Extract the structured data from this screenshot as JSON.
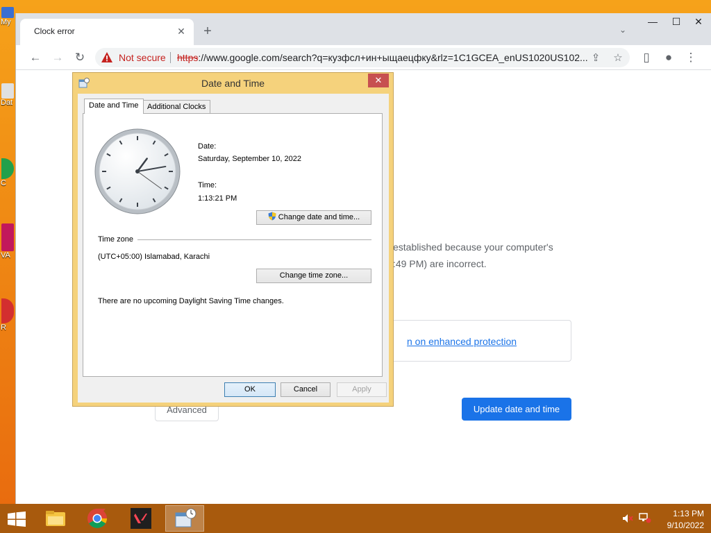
{
  "desktop": {
    "icons": [
      {
        "label": "My",
        "color": "#3b6fd1"
      },
      {
        "label": "Dat",
        "color": "#e0e0e0"
      },
      {
        "label": "C",
        "color": "#22a04b"
      },
      {
        "label": "VA",
        "color": "#c2185b"
      },
      {
        "label": "R",
        "color": "#d32f2f"
      }
    ]
  },
  "browser": {
    "tab_title": "Clock error",
    "url_scheme": "https",
    "url_rest": "://www.google.com/search?q=кузфсл+ин+ыщаецфку&rlz=1C1GCEA_enUS1020US102...",
    "not_secure": "Not secure",
    "icons": {
      "back": "←",
      "forward": "→",
      "reload": "↻",
      "share": "⇪",
      "star": "☆",
      "sidepanel": "▯",
      "profile": "●",
      "menu": "⋮",
      "newtab": "+",
      "close": "✕",
      "tabsearch": "⌄",
      "minimize": "—",
      "maximize": "☐",
      "window_close": "✕"
    }
  },
  "page": {
    "error_line1": "established because your computer's",
    "error_line2": ":49 PM) are incorrect.",
    "enhanced_link": "n on enhanced protection",
    "advanced_button": "Advanced",
    "update_button": "Update date and time"
  },
  "dialog": {
    "title": "Date and Time",
    "close": "✕",
    "tabs": [
      "Date and Time",
      "Additional Clocks"
    ],
    "date_label": "Date:",
    "date_value": "Saturday, September 10, 2022",
    "time_label": "Time:",
    "time_value": "1:13:21 PM",
    "change_datetime_button": "Change date and time...",
    "timezone_heading": "Time zone",
    "timezone_value": "(UTC+05:00) Islamabad, Karachi",
    "change_timezone_button": "Change time zone...",
    "dst_text": "There are no upcoming Daylight Saving Time changes.",
    "ok_button": "OK",
    "cancel_button": "Cancel",
    "apply_button": "Apply",
    "clock": {
      "hour": 1,
      "minute": 13,
      "second": 21
    }
  },
  "taskbar": {
    "time": "1:13 PM",
    "date": "9/10/2022"
  }
}
